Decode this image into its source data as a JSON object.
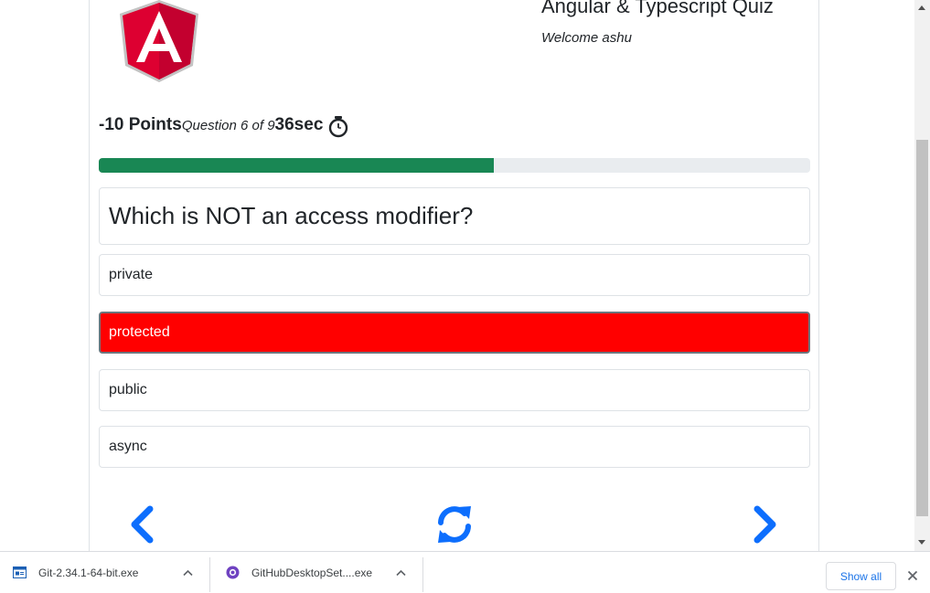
{
  "header": {
    "title": "Angular & Typescript Quiz",
    "welcome": "Welcome ashu",
    "logo_icon": "angular-logo"
  },
  "stats": {
    "points": "-10 Points",
    "question_counter": "Question 6 of 9",
    "timer": "36sec",
    "timer_icon": "stopwatch-icon"
  },
  "progress": {
    "fraction": 0.555,
    "color": "#198754"
  },
  "question": {
    "text": "Which is NOT an access modifier?"
  },
  "options": [
    {
      "label": "private",
      "selected": false
    },
    {
      "label": "protected",
      "selected": true
    },
    {
      "label": "public",
      "selected": false
    },
    {
      "label": "async",
      "selected": false
    }
  ],
  "navigation": {
    "prev_icon": "chevron-left-icon",
    "refresh_icon": "refresh-icon",
    "next_icon": "chevron-right-icon",
    "accent": "#0d6efd"
  },
  "downloads": {
    "items": [
      {
        "name": "Git-2.34.1-64-bit.exe",
        "icon": "installer-icon"
      },
      {
        "name": "GitHubDesktopSet....exe",
        "icon": "github-icon"
      }
    ],
    "show_all": "Show all"
  },
  "colors": {
    "selected_option": "#ff0000",
    "angular_red": "#dd0031"
  }
}
